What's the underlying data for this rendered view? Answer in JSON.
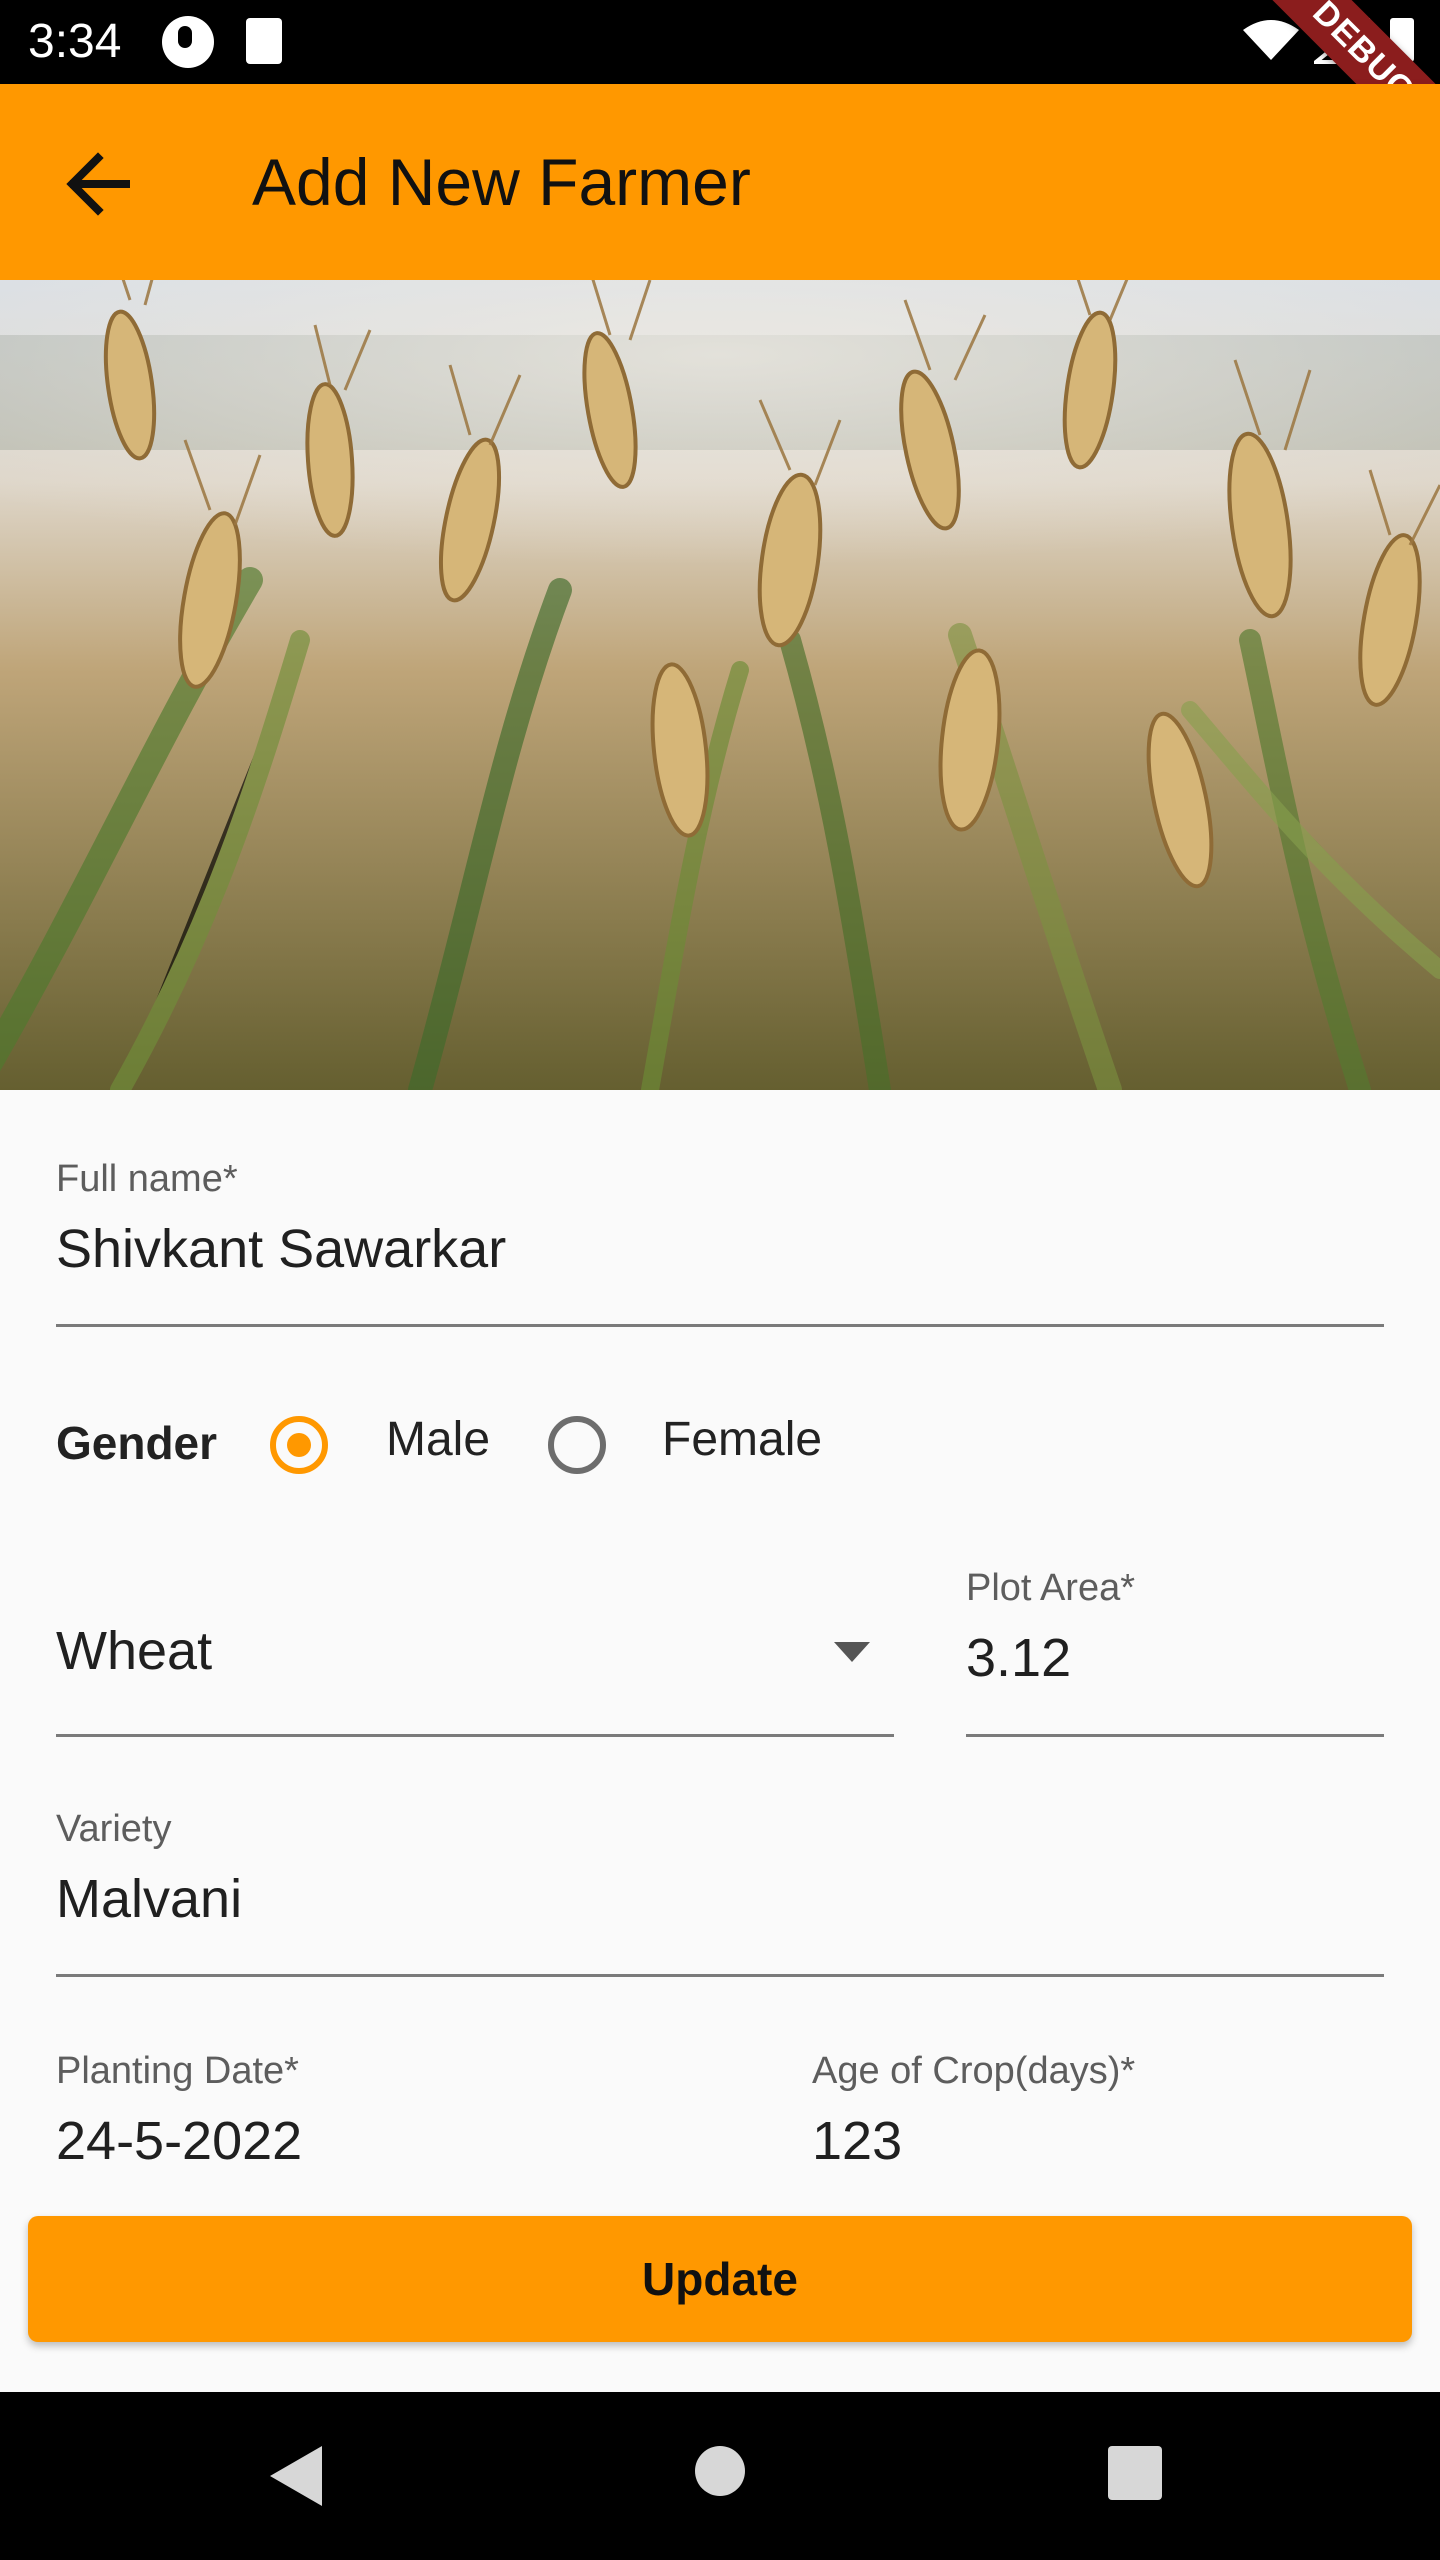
{
  "status_bar": {
    "time": "3:34",
    "debug_ribbon": "DEBUG"
  },
  "app_bar": {
    "title": "Add New Farmer",
    "back_icon": "arrow-left-icon"
  },
  "form": {
    "full_name": {
      "label": "Full name*",
      "value": "Shivkant Sawarkar"
    },
    "gender": {
      "label": "Gender",
      "options": [
        {
          "label": "Male",
          "selected": true
        },
        {
          "label": "Female",
          "selected": false
        }
      ]
    },
    "crop": {
      "value": "Wheat",
      "icon": "dropdown-arrow-icon"
    },
    "plot_area": {
      "label": "Plot Area*",
      "value": "3.12"
    },
    "variety": {
      "label": "Variety",
      "value": "Malvani"
    },
    "planting_date": {
      "label": "Planting Date*",
      "value": "24-5-2022"
    },
    "age_of_crop": {
      "label": "Age of Crop(days)*",
      "value": "123"
    }
  },
  "actions": {
    "update_label": "Update"
  },
  "colors": {
    "accent": "#FF9800",
    "debug_ribbon": "#8B1D1D",
    "background": "#FAFAFA"
  }
}
